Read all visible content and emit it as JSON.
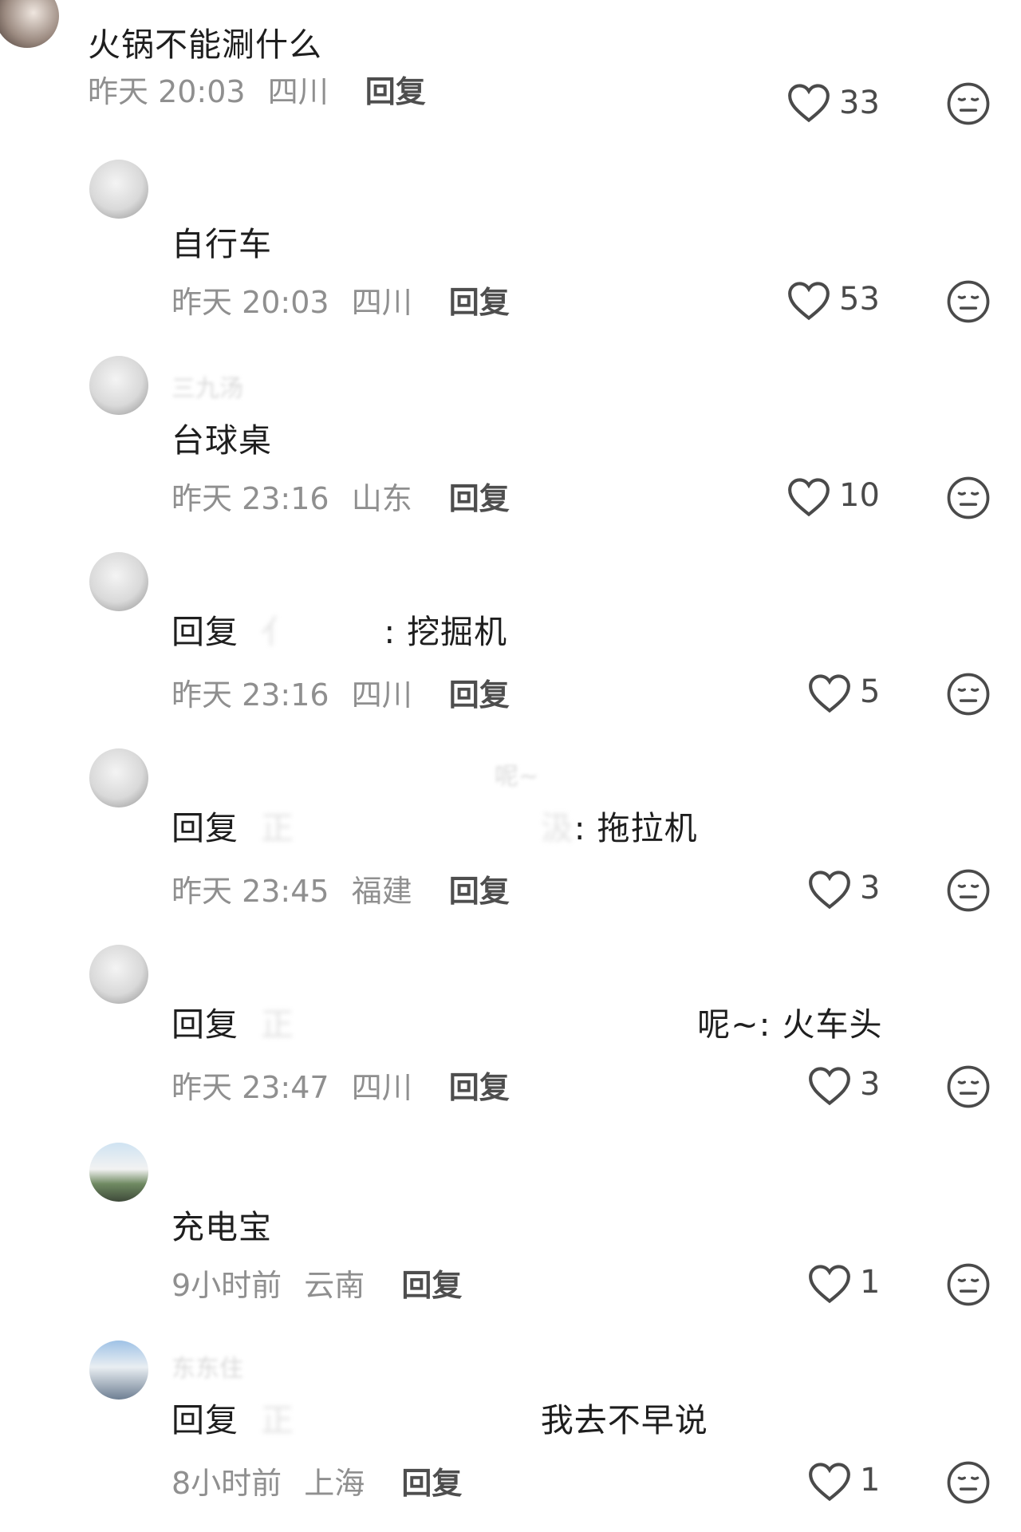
{
  "comments": [
    {
      "kind": "top",
      "username": "",
      "text": "火锅不能涮什么",
      "reply_prefix": "",
      "time": "昨天 20:03",
      "region": "四川",
      "reply_label": "回复",
      "likes": "33"
    },
    {
      "kind": "sub",
      "username": "",
      "text": "自行车",
      "reply_prefix": "",
      "time": "昨天 20:03",
      "region": "四川",
      "reply_label": "回复",
      "likes": "53"
    },
    {
      "kind": "sub",
      "username": "三九汤",
      "text": "台球桌",
      "reply_prefix": "",
      "time": "昨天 23:16",
      "region": "山东",
      "reply_label": "回复",
      "likes": "10"
    },
    {
      "kind": "sub",
      "username": "",
      "text": ": 挖掘机",
      "reply_prefix": "回复",
      "time": "昨天 23:16",
      "region": "四川",
      "reply_label": "回复",
      "likes": "5"
    },
    {
      "kind": "sub",
      "username": "呢~",
      "text": ": 拖拉机",
      "reply_prefix": "回复",
      "time": "昨天 23:45",
      "region": "福建",
      "reply_label": "回复",
      "likes": "3"
    },
    {
      "kind": "sub",
      "username": "",
      "text": "呢~: 火车头",
      "reply_prefix": "回复",
      "time": "昨天 23:47",
      "region": "四川",
      "reply_label": "回复",
      "likes": "3"
    },
    {
      "kind": "sub",
      "username": "",
      "text": "充电宝",
      "reply_prefix": "",
      "time": "9小时前",
      "region": "云南",
      "reply_label": "回复",
      "likes": "1"
    },
    {
      "kind": "sub",
      "username": "东东住",
      "text": "我去不早说",
      "reply_prefix": "回复",
      "time": "8小时前",
      "region": "上海",
      "reply_label": "回复",
      "likes": "1"
    }
  ],
  "icons": {
    "like": "heart-outline-icon",
    "dislike": "neutral-face-icon"
  },
  "colors": {
    "text_primary": "#1e1e1e",
    "text_meta": "#8f8f8f",
    "icon": "#4a4a4a"
  }
}
